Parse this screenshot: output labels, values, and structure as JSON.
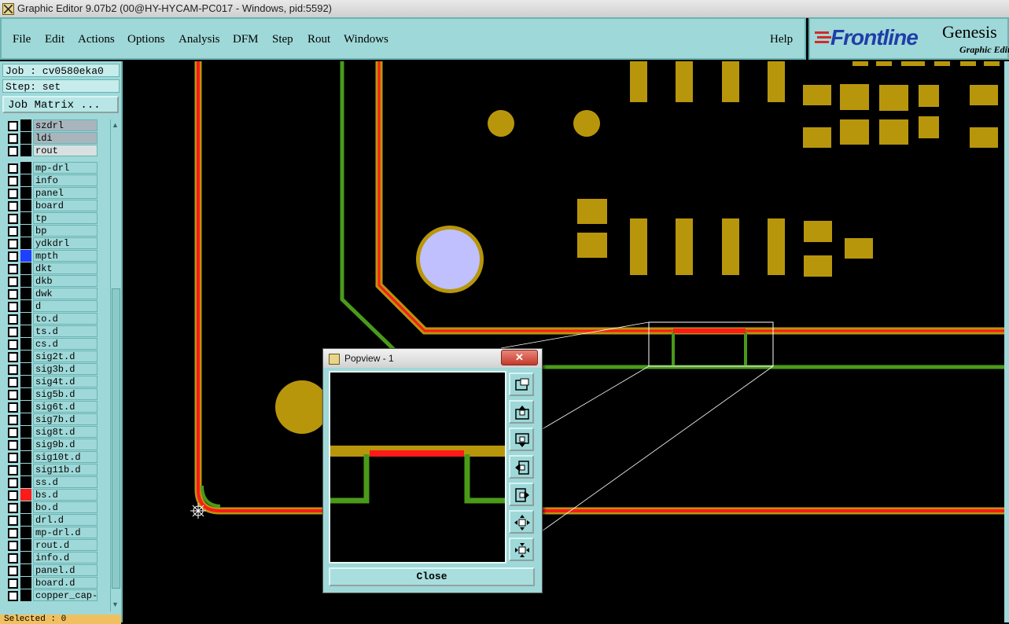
{
  "window": {
    "title": "Graphic Editor 9.07b2 (00@HY-HYCAM-PC017 - Windows, pid:5592)"
  },
  "menubar": {
    "items": [
      "File",
      "Edit",
      "Actions",
      "Options",
      "Analysis",
      "DFM",
      "Step",
      "Rout",
      "Windows"
    ],
    "help": "Help"
  },
  "logo": {
    "brand": "Frontline",
    "product": "Genesis",
    "subtitle": "Graphic Editor"
  },
  "job": {
    "job_label": "Job : cv0580eka0",
    "step_label": "Step: set",
    "matrix_button": "Job Matrix ..."
  },
  "layers": [
    {
      "name": "szdrl",
      "style": "grey"
    },
    {
      "name": "ldi",
      "style": "grey"
    },
    {
      "name": "rout",
      "style": "light"
    },
    {
      "name": "mp-drl"
    },
    {
      "name": "info"
    },
    {
      "name": "panel"
    },
    {
      "name": "board"
    },
    {
      "name": "tp"
    },
    {
      "name": "bp"
    },
    {
      "name": "ydkdrl"
    },
    {
      "name": "mpth",
      "color": "#1f3fff"
    },
    {
      "name": "dkt"
    },
    {
      "name": "dkb"
    },
    {
      "name": "dwk"
    },
    {
      "name": "d"
    },
    {
      "name": "to.d"
    },
    {
      "name": "ts.d"
    },
    {
      "name": "cs.d"
    },
    {
      "name": "sig2t.d"
    },
    {
      "name": "sig3b.d"
    },
    {
      "name": "sig4t.d"
    },
    {
      "name": "sig5b.d"
    },
    {
      "name": "sig6t.d"
    },
    {
      "name": "sig7b.d"
    },
    {
      "name": "sig8t.d"
    },
    {
      "name": "sig9b.d"
    },
    {
      "name": "sig10t.d"
    },
    {
      "name": "sig11b.d"
    },
    {
      "name": "ss.d"
    },
    {
      "name": "bs.d",
      "color": "#ff1a1a"
    },
    {
      "name": "bo.d"
    },
    {
      "name": "drl.d"
    },
    {
      "name": "mp-drl.d"
    },
    {
      "name": "rout.d"
    },
    {
      "name": "info.d"
    },
    {
      "name": "panel.d"
    },
    {
      "name": "board.d"
    },
    {
      "name": "copper_cap-t"
    }
  ],
  "status": {
    "selected": "Selected : 0"
  },
  "popview": {
    "title": "Popview - 1",
    "close_button": "Close",
    "tools": [
      "zoom-fit-icon",
      "pan-up-icon",
      "pan-down-icon",
      "pan-left-icon",
      "pan-right-icon",
      "zoom-out-icon",
      "zoom-in-icon"
    ]
  },
  "colors": {
    "panel": "#9fd8d8",
    "pad": "#b8960c",
    "trace_red": "#ff1a1a",
    "trace_green": "#4a9a1a",
    "hole": "#c0c0ff"
  }
}
